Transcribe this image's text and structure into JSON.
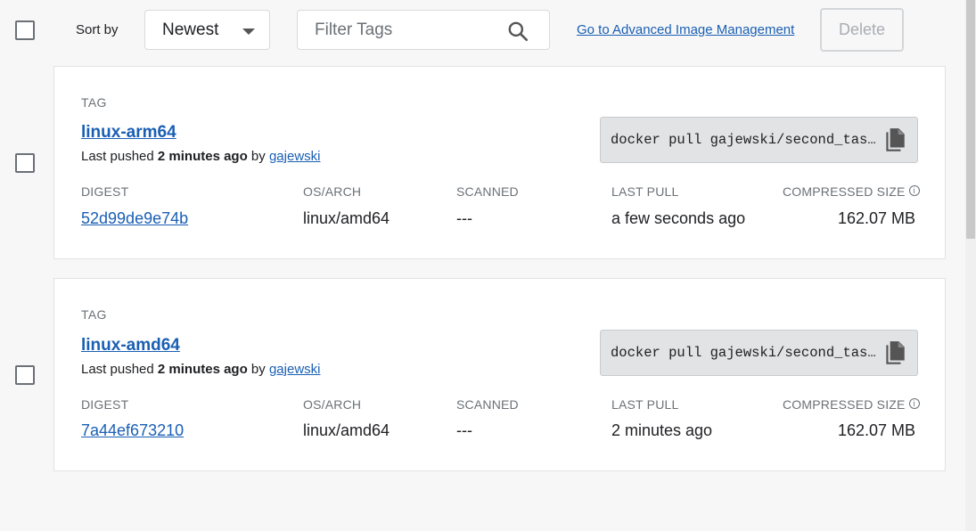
{
  "toolbar": {
    "sort_label": "Sort by",
    "sort_value": "Newest",
    "filter_placeholder": "Filter Tags",
    "advanced_link": "Go to Advanced Image Management",
    "delete_label": "Delete"
  },
  "columns": {
    "tag": "TAG",
    "digest": "DIGEST",
    "os_arch": "OS/ARCH",
    "scanned": "SCANNED",
    "last_pull": "LAST PULL",
    "compressed_size": "COMPRESSED SIZE"
  },
  "tags": [
    {
      "name": "linux-arm64",
      "pushed_prefix": "Last pushed ",
      "pushed_time": "2 minutes ago",
      "pushed_by": " by ",
      "pusher": "gajewski",
      "pull_command": "docker pull gajewski/second_task…",
      "digest": "52d99de9e74b",
      "os_arch": "linux/amd64",
      "scanned": "---",
      "last_pull": "a few seconds ago",
      "size": "162.07 MB"
    },
    {
      "name": "linux-amd64",
      "pushed_prefix": "Last pushed ",
      "pushed_time": "2 minutes ago",
      "pushed_by": " by ",
      "pusher": "gajewski",
      "pull_command": "docker pull gajewski/second_task…",
      "digest": "7a44ef673210",
      "os_arch": "linux/amd64",
      "scanned": "---",
      "last_pull": "2 minutes ago",
      "size": "162.07 MB"
    }
  ],
  "icons": {
    "search": "search-icon",
    "copy": "copy-icon",
    "info": "info-icon",
    "dropdown": "chevron-down-icon"
  }
}
